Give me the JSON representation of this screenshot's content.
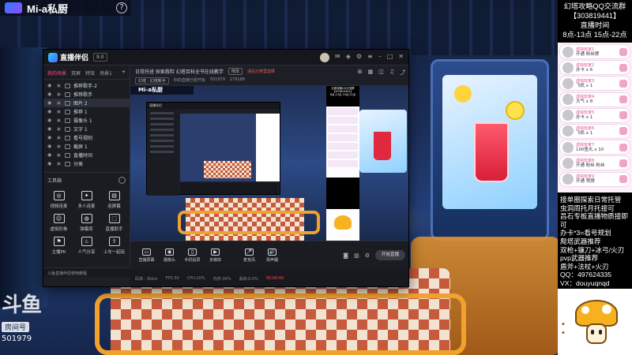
{
  "overlay": {
    "channel_name": "Mi-a私厨",
    "help": "?",
    "douyu_logo": "斗鱼",
    "room_label": "房间号",
    "room_id": "501979"
  },
  "app": {
    "brand": "直播伴侣",
    "version": "9.0",
    "scene_tabs": [
      "我的场景",
      "双屏",
      "特效",
      "场景1"
    ],
    "add_tab": "+",
    "sources": [
      {
        "label": "推荐歌手-2",
        "selected": false
      },
      {
        "label": "推荐歌手",
        "selected": false
      },
      {
        "label": "图片 2",
        "selected": true
      },
      {
        "label": "推荐 1",
        "selected": false
      },
      {
        "label": "摄像头 1",
        "selected": false
      },
      {
        "label": "文字 1",
        "selected": false
      },
      {
        "label": "看号规则",
        "selected": false
      },
      {
        "label": "截屏 1",
        "selected": false
      },
      {
        "label": "直播时间",
        "selected": false
      },
      {
        "label": "分类",
        "selected": false
      }
    ],
    "tools_title": "工具箱",
    "tools": [
      {
        "icon": "◎",
        "label": "视频连麦"
      },
      {
        "icon": "✦",
        "label": "多人连麦"
      },
      {
        "icon": "▤",
        "label": "连屏幕"
      },
      {
        "icon": "☺",
        "label": "虚拟形象"
      },
      {
        "icon": "◍",
        "label": "弹幕库"
      },
      {
        "icon": "⬚",
        "label": "直播助手"
      },
      {
        "icon": "⚑",
        "label": "主播PK"
      },
      {
        "icon": "♨",
        "label": "人气分享"
      },
      {
        "icon": "⇪",
        "label": "上车一起玩"
      }
    ],
    "left_footer": "斗鱼直播伴侣使用教程",
    "stream_title": "日常托班 探索救险 幻塔百科全书在线教学",
    "edit_btn": "修改",
    "warning": "请在分类里选择",
    "category": "幻塔 · 幻塔新手",
    "live_hint": "你的直播已经开始",
    "viewer_count": "501979",
    "hot_count": "279188",
    "preview_channel": "Mi-a私厨",
    "toolbar": [
      {
        "icon": "▭",
        "label": "直播屏幕"
      },
      {
        "icon": "◉",
        "label": "摄像头"
      },
      {
        "icon": "▯",
        "label": "手机投屏"
      },
      {
        "icon": "▶",
        "label": "多媒体"
      },
      {
        "icon": "🎤",
        "label": "麦克风"
      },
      {
        "icon": "🔊",
        "label": "扬声器"
      }
    ],
    "start_btn": "开始直播",
    "status": {
      "bitrate": "码率：0kb/s",
      "fps": "FPS:30",
      "cpu": "CPU:20%",
      "mem": "内存:34%",
      "drop": "丢帧:0.0%",
      "time": "00:00:00"
    },
    "nested_title": "直播伴侣"
  },
  "right_panel": {
    "group_line1": "幻塔攻略QQ交流群",
    "group_line2": "【303819441】",
    "schedule_title": "直播时间",
    "schedule": "8点-13点 15点-22点",
    "gifts": [
      {
        "nick": "虚拟玩家1",
        "gift": "开通 粉丝牌"
      },
      {
        "nick": "虚拟玩家2",
        "gift": "办卡 x 6"
      },
      {
        "nick": "虚拟玩家3",
        "gift": "飞机 x 1"
      },
      {
        "nick": "虚拟玩家4",
        "gift": "大气 x 8"
      },
      {
        "nick": "虚拟玩家5",
        "gift": "办卡 x 1"
      },
      {
        "nick": "虚拟玩家6",
        "gift": "飞机 x 1"
      },
      {
        "nick": "虚拟玩家7",
        "gift": "100鱼丸 x 10"
      },
      {
        "nick": "虚拟玩家8",
        "gift": "开通 粉丝 粉丝"
      },
      {
        "nick": "虚拟玩家9",
        "gift": "开通 赞牌"
      }
    ],
    "notes": [
      "接单圈探索日常托管",
      "虫洞周托月托接可",
      "昌石专板直播物质接即可",
      "办卡*3=看号规划",
      "爬塔武器推荐",
      "双枪+镰刀+冰弓/火刃",
      "pvp武器推荐",
      "盾斧+法杖+火刃",
      "QQ：497624335",
      "VX：douyuqnqd"
    ]
  },
  "colors": {
    "accent": "#ff4d7e",
    "app_bg": "#1c1f26",
    "right_panel_bg": "#000000"
  }
}
